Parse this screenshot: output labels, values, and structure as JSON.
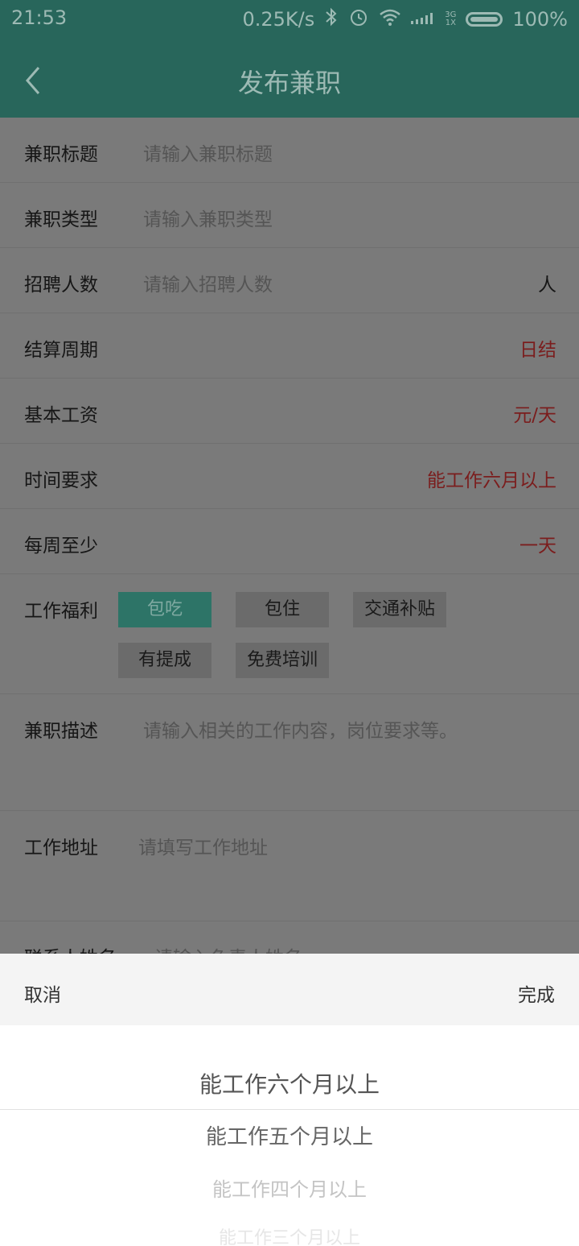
{
  "status_bar": {
    "time": "21:53",
    "speed": "0.25K/s",
    "network_top": "3G",
    "network_bottom": "1X",
    "battery": "100%"
  },
  "header": {
    "title": "发布兼职"
  },
  "form": {
    "title_label": "兼职标题",
    "title_placeholder": "请输入兼职标题",
    "type_label": "兼职类型",
    "type_placeholder": "请输入兼职类型",
    "count_label": "招聘人数",
    "count_placeholder": "请输入招聘人数",
    "count_unit": "人",
    "cycle_label": "结算周期",
    "cycle_value": "日结",
    "salary_label": "基本工资",
    "salary_value": "元/天",
    "time_label": "时间要求",
    "time_value": "能工作六月以上",
    "week_label": "每周至少",
    "week_value": "一天",
    "benefits_label": "工作福利",
    "benefits": [
      "包吃",
      "包住",
      "交通补贴",
      "有提成",
      "免费培训"
    ],
    "desc_label": "兼职描述",
    "desc_placeholder": "请输入相关的工作内容，岗位要求等。",
    "address_label": "工作地址",
    "address_placeholder": "请填写工作地址",
    "contact_label": "联系人姓名",
    "contact_placeholder": "请输入负责人姓名"
  },
  "picker": {
    "cancel": "取消",
    "done": "完成",
    "options": [
      "能工作六个月以上",
      "能工作五个月以上",
      "能工作四个月以上",
      "能工作三个月以上"
    ]
  },
  "colors": {
    "primary": "#3aa696",
    "accent_red": "#c0392b"
  }
}
